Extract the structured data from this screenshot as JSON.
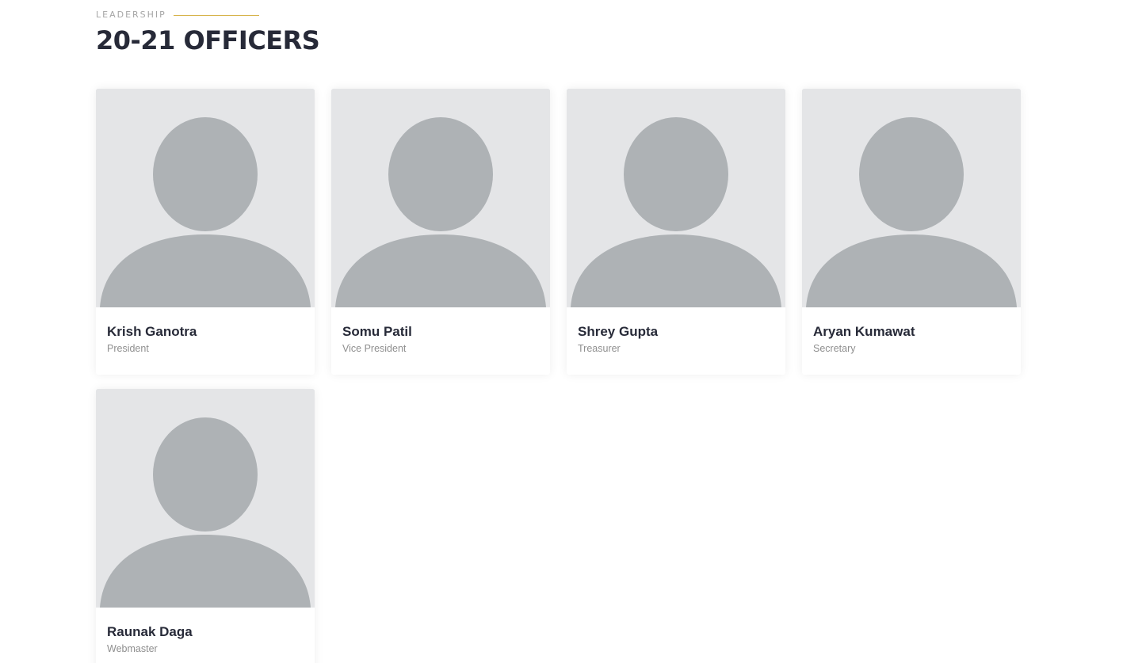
{
  "section": {
    "eyebrow": "LEADERSHIP",
    "title": "20-21 OFFICERS"
  },
  "officers": [
    {
      "name": "Krish Ganotra",
      "role": "President",
      "photo_icon": "user-silhouette-icon"
    },
    {
      "name": "Somu Patil",
      "role": "Vice President",
      "photo_icon": "user-silhouette-icon"
    },
    {
      "name": "Shrey Gupta",
      "role": "Treasurer",
      "photo_icon": "user-silhouette-icon"
    },
    {
      "name": "Aryan Kumawat",
      "role": "Secretary",
      "photo_icon": "user-silhouette-icon"
    },
    {
      "name": "Raunak Daga",
      "role": "Webmaster",
      "photo_icon": "user-silhouette-icon"
    }
  ],
  "colors": {
    "accent_line": "#d7b34a",
    "title": "#272a38",
    "eyebrow": "#a6a6a6",
    "avatar_bg": "#e4e5e7",
    "avatar_silhouette": "#aeb2b5",
    "role_text": "#8f8f8f"
  }
}
